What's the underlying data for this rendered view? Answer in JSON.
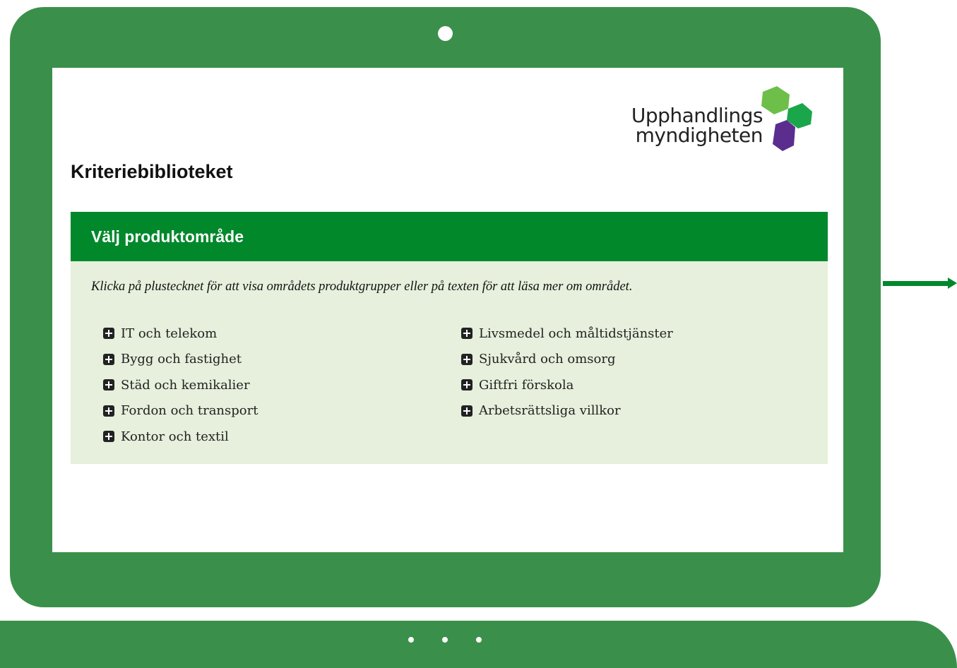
{
  "page": {
    "title": "Kriteriebiblioteket"
  },
  "logo": {
    "line1": "Upphandlings",
    "line2": "myndigheten"
  },
  "panel": {
    "header": "Välj produktområde",
    "instruction": "Klicka på plustecknet för att visa områdets produktgrupper eller på texten för att läsa mer om området.",
    "items_left": [
      {
        "label": "IT och telekom"
      },
      {
        "label": "Bygg och fastighet"
      },
      {
        "label": "Städ och kemikalier"
      },
      {
        "label": "Fordon och transport"
      },
      {
        "label": "Kontor och textil"
      }
    ],
    "items_right": [
      {
        "label": "Livsmedel och måltidstjänster"
      },
      {
        "label": "Sjukvård och omsorg"
      },
      {
        "label": "Giftfri förskola"
      },
      {
        "label": "Arbetsrättsliga villkor"
      }
    ]
  },
  "colors": {
    "frame": "#3a904a",
    "header": "#00882b",
    "panel_bg": "#e6f0dc",
    "logo_light_green": "#6dbf4a",
    "logo_green": "#1aa64a",
    "logo_purple": "#5b2d8e"
  },
  "icons": {
    "expand": "plus-square-icon"
  }
}
